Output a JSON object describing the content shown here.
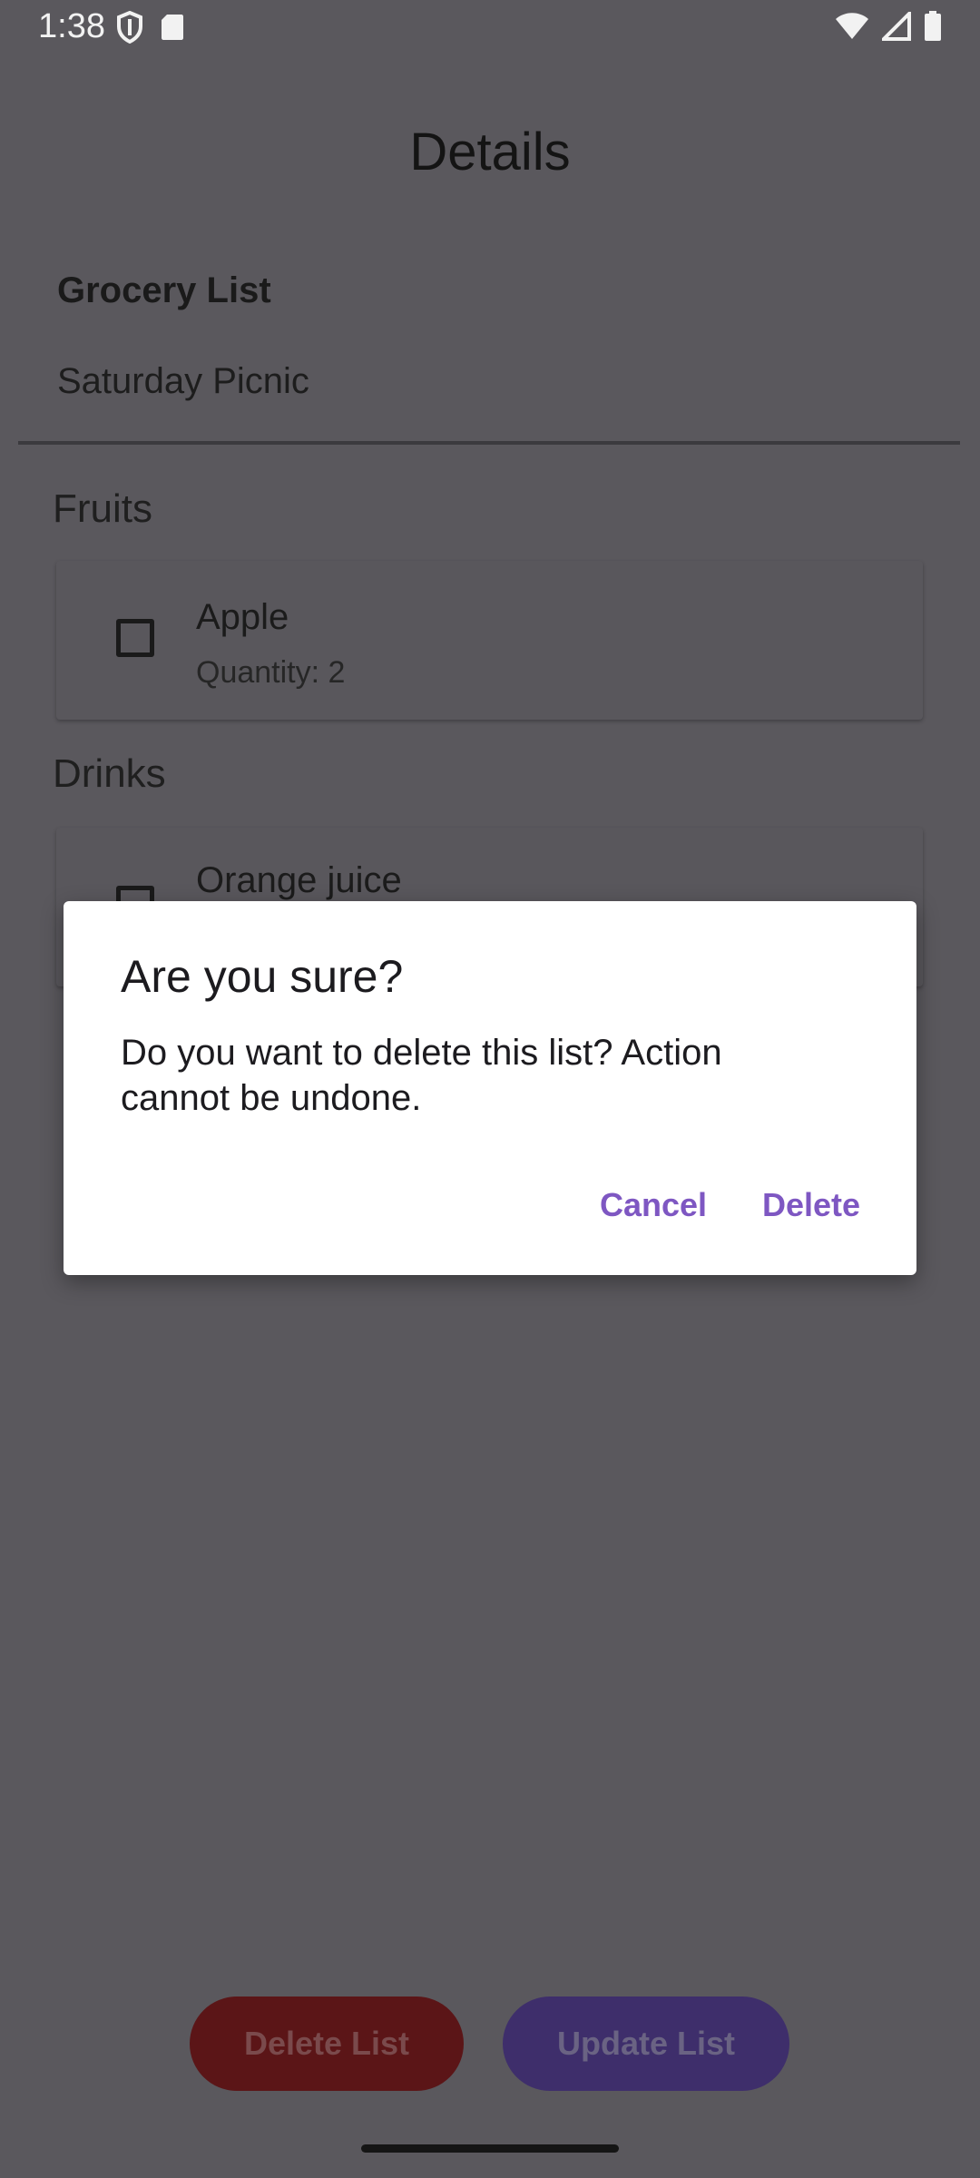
{
  "status_bar": {
    "time": "1:38",
    "left_icons": [
      "shield-icon",
      "sd-card-icon"
    ],
    "right_icons": [
      "wifi-icon",
      "signal-icon",
      "battery-icon"
    ]
  },
  "header": {
    "title": "Details"
  },
  "list": {
    "label": "Grocery List",
    "name": "Saturday Picnic"
  },
  "categories": [
    {
      "title": "Fruits",
      "items": [
        {
          "name": "Apple",
          "quantity": "Quantity: 2",
          "checked": false
        }
      ]
    },
    {
      "title": "Drinks",
      "items": [
        {
          "name": "Orange juice",
          "checked": false
        }
      ]
    }
  ],
  "actions": {
    "delete_label": "Delete List",
    "update_label": "Update List"
  },
  "dialog": {
    "title": "Are you sure?",
    "message": "Do you want to delete this list? Action cannot be undone.",
    "cancel_label": "Cancel",
    "confirm_label": "Delete"
  },
  "colors": {
    "scrim_background": "#5a585d",
    "dialog_accent": "#7e57c2",
    "delete_button": "#5b1517",
    "update_button": "#3e2e6b"
  }
}
